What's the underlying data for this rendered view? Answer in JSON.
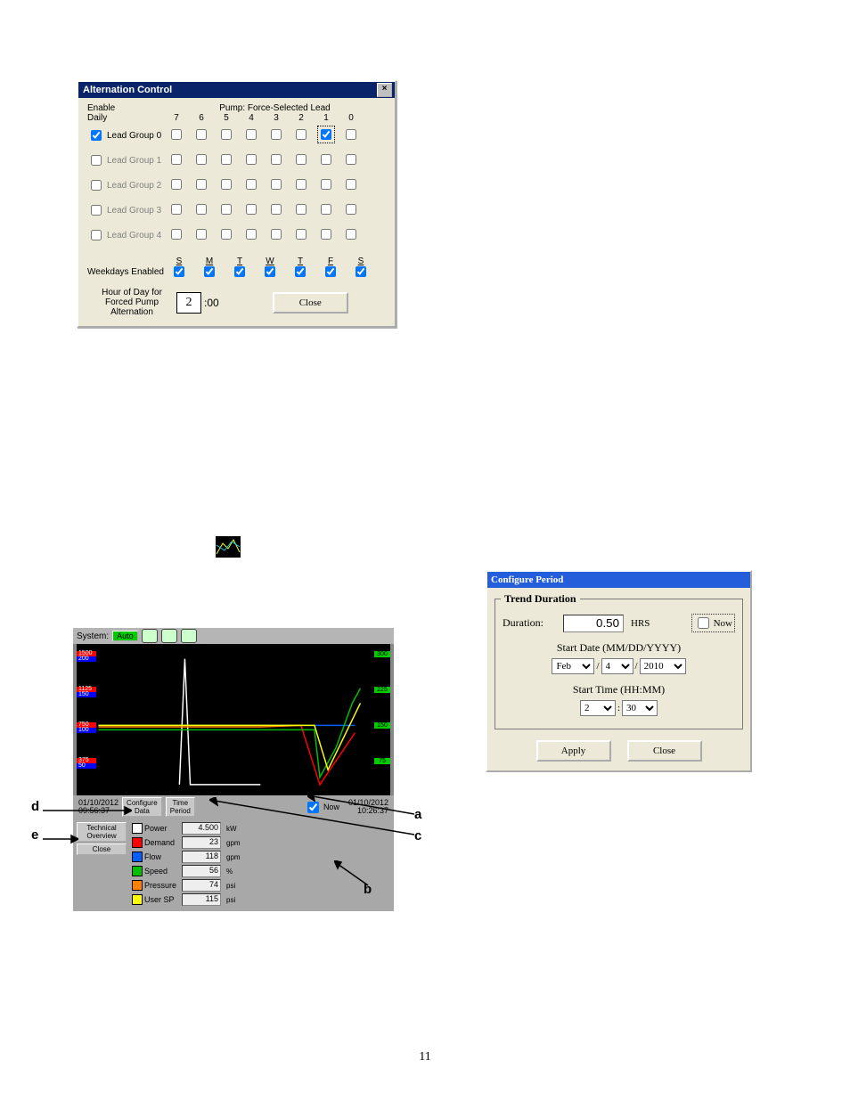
{
  "page_number": "11",
  "alt": {
    "title": "Alternation Control",
    "enable_lbl": "Enable",
    "daily_lbl": "Daily",
    "fs_label": "Pump: Force-Selected Lead",
    "cols": [
      "7",
      "6",
      "5",
      "4",
      "3",
      "2",
      "1",
      "0"
    ],
    "groups": [
      {
        "label": "Lead Group 0",
        "enabled": true,
        "checks": [
          false,
          false,
          false,
          false,
          false,
          false,
          true,
          false
        ]
      },
      {
        "label": "Lead Group 1",
        "enabled": false,
        "checks": [
          false,
          false,
          false,
          false,
          false,
          false,
          false,
          false
        ]
      },
      {
        "label": "Lead Group 2",
        "enabled": false,
        "checks": [
          false,
          false,
          false,
          false,
          false,
          false,
          false,
          false
        ]
      },
      {
        "label": "Lead Group 3",
        "enabled": false,
        "checks": [
          false,
          false,
          false,
          false,
          false,
          false,
          false,
          false
        ]
      },
      {
        "label": "Lead Group 4",
        "enabled": false,
        "checks": [
          false,
          false,
          false,
          false,
          false,
          false,
          false,
          false
        ]
      }
    ],
    "weekdays_lbl": "Weekdays Enabled",
    "weekdays": [
      "S",
      "M",
      "T",
      "W",
      "T",
      "F",
      "S"
    ],
    "weekday_checks": [
      true,
      true,
      true,
      true,
      true,
      true,
      true
    ],
    "hour_lbl": "Hour of Day for\nForced Pump\nAlternation",
    "hour_val": "2",
    "hour_suf": ":00",
    "close": "Close"
  },
  "cfg": {
    "title": "Configure Period",
    "box_lbl": "Trend Duration",
    "dur_lbl": "Duration:",
    "dur_val": "0.50",
    "hrs": "HRS",
    "now": "Now",
    "now_checked": false,
    "start_date_lbl": "Start Date (MM/DD/YYYY)",
    "month": "Feb",
    "day": "4",
    "year": "2010",
    "start_time_lbl": "Start Time (HH:MM)",
    "hh": "2",
    "mm": "30",
    "apply": "Apply",
    "close": "Close"
  },
  "trend": {
    "system_lbl": "System:",
    "auto": "Auto",
    "ts_left": "01/10/2012\n09:56:37",
    "ts_right": "01/10/2012\n10:26:37",
    "cfg_data_btn": "Configure\nData",
    "time_period_btn": "Time\nPeriod",
    "now_lbl": "Now",
    "tech_btn": "Technical\nOverview",
    "close_btn": "Close",
    "legend": [
      {
        "name": "Power",
        "val": "4.500",
        "unit": "kW",
        "color": "#ffffff"
      },
      {
        "name": "Demand",
        "val": "23",
        "unit": "gpm",
        "color": "#ff0000"
      },
      {
        "name": "Flow",
        "val": "118",
        "unit": "gpm",
        "color": "#0060ff"
      },
      {
        "name": "Speed",
        "val": "56",
        "unit": "%",
        "color": "#00c000"
      },
      {
        "name": "Pressure",
        "val": "74",
        "unit": "psi",
        "color": "#ff8000"
      },
      {
        "name": "User SP",
        "val": "115",
        "unit": "psi",
        "color": "#ffff00"
      }
    ],
    "y_left": [
      {
        "top": "1500",
        "bot": "200",
        "c1": "#f00",
        "c2": "#00f"
      },
      {
        "top": "1125",
        "bot": "150",
        "c1": "#f00",
        "c2": "#00f"
      },
      {
        "top": "750",
        "bot": "100",
        "c1": "#f00",
        "c2": "#00f"
      },
      {
        "top": "375",
        "bot": "50",
        "c1": "#f00",
        "c2": "#00f"
      }
    ],
    "y_right": [
      "300",
      "225",
      "150",
      "75"
    ]
  },
  "callouts": {
    "a": "a",
    "b": "b",
    "c": "c",
    "d": "d",
    "e": "e"
  },
  "chart_data": {
    "type": "line",
    "x_range": [
      "09:56:37",
      "10:26:37"
    ],
    "y_left_scales": {
      "red": [
        0,
        1500
      ],
      "blue": [
        0,
        200
      ]
    },
    "y_right_scale": [
      0,
      300
    ],
    "series": [
      {
        "name": "Power",
        "color": "#ffffff",
        "points": [
          [
            0.3,
            0.95
          ],
          [
            0.32,
            0.1
          ],
          [
            0.34,
            0.95
          ],
          [
            0.6,
            0.95
          ]
        ]
      },
      {
        "name": "Demand",
        "color": "#ff0000",
        "points": [
          [
            0.0,
            0.55
          ],
          [
            0.75,
            0.55
          ],
          [
            0.82,
            0.95
          ],
          [
            0.95,
            0.6
          ]
        ]
      },
      {
        "name": "Flow",
        "color": "#0060ff",
        "points": [
          [
            0.0,
            0.55
          ],
          [
            0.95,
            0.55
          ]
        ]
      },
      {
        "name": "Speed",
        "color": "#00c000",
        "points": [
          [
            0.0,
            0.58
          ],
          [
            0.8,
            0.58
          ],
          [
            0.82,
            0.9
          ],
          [
            0.85,
            0.8
          ],
          [
            0.88,
            0.7
          ],
          [
            0.91,
            0.55
          ],
          [
            0.94,
            0.4
          ],
          [
            0.97,
            0.3
          ]
        ]
      },
      {
        "name": "Pressure",
        "color": "#ff8000",
        "points": [
          [
            0.0,
            0.56
          ],
          [
            0.6,
            0.56
          ],
          [
            0.75,
            0.55
          ]
        ]
      },
      {
        "name": "User SP",
        "color": "#ffff00",
        "points": [
          [
            0.0,
            0.55
          ],
          [
            0.8,
            0.55
          ],
          [
            0.85,
            0.85
          ],
          [
            0.97,
            0.4
          ]
        ]
      }
    ]
  }
}
